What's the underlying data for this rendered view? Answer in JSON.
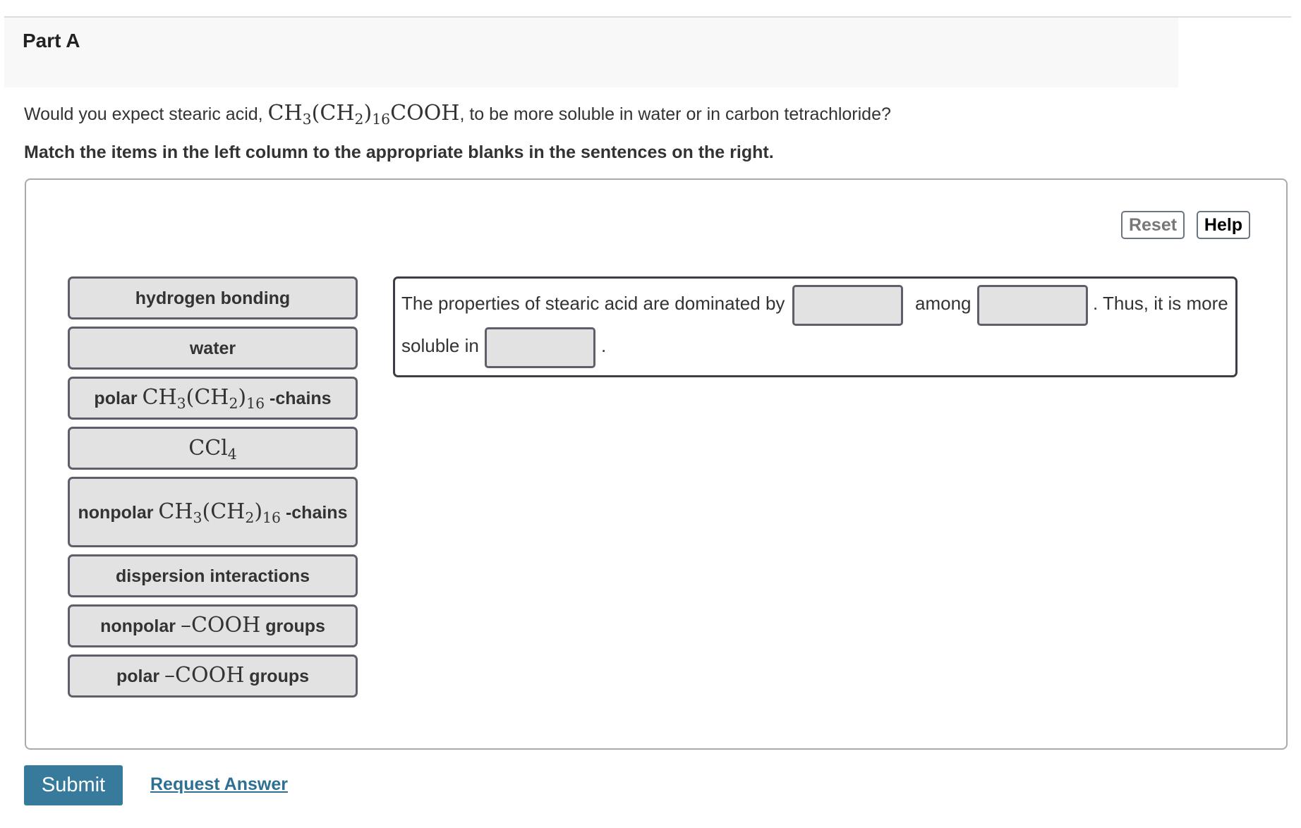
{
  "part": {
    "title": "Part A"
  },
  "question": {
    "prefix": "Would you expect stearic acid, ",
    "formula": {
      "a": "CH",
      "a_sub": "3",
      "b": "(CH",
      "b_sub": "2",
      "c": ")",
      "c_sub": "16",
      "d": "COOH"
    },
    "suffix": ", to be more soluble in water or in carbon tetrachloride?"
  },
  "instructions": "Match the items in the left column to the appropriate blanks in the sentences on the right.",
  "toolbar": {
    "reset_label": "Reset",
    "help_label": "Help"
  },
  "choices": [
    {
      "id": "hydrogen-bonding",
      "text": "hydrogen bonding"
    },
    {
      "id": "water",
      "text": "water"
    },
    {
      "id": "polar-chains",
      "prefix": "polar ",
      "formula": {
        "a": "CH",
        "a_sub": "3",
        "b": "(CH",
        "b_sub": "2",
        "c": ")",
        "c_sub": "16"
      },
      "suffix": " -chains"
    },
    {
      "id": "ccl4",
      "formula": {
        "a": "CCl",
        "a_sub": "4"
      }
    },
    {
      "id": "nonpolar-chains",
      "prefix": "nonpolar ",
      "formula": {
        "a": "CH",
        "a_sub": "3",
        "b": "(CH",
        "b_sub": "2",
        "c": ")",
        "c_sub": "16"
      },
      "suffix": " -chains"
    },
    {
      "id": "dispersion-interactions",
      "text": "dispersion interactions"
    },
    {
      "id": "nonpolar-cooh",
      "prefix": "nonpolar ",
      "formula": "–COOH",
      "suffix": " groups"
    },
    {
      "id": "polar-cooh",
      "prefix": "polar ",
      "formula": "–COOH",
      "suffix": " groups"
    }
  ],
  "sentence": {
    "part1": "The properties of stearic acid are dominated by",
    "part2": "among",
    "part3": ". Thus, it is more",
    "part4": "soluble in",
    "part5": ".",
    "blanks": [
      "",
      "",
      ""
    ]
  },
  "actions": {
    "submit_label": "Submit",
    "request_answer_label": "Request Answer"
  },
  "colors": {
    "submit_bg": "#377a9b",
    "link": "#2e6f94",
    "chip_bg": "#e2e2e2",
    "header_bg": "#f8f8f8"
  }
}
